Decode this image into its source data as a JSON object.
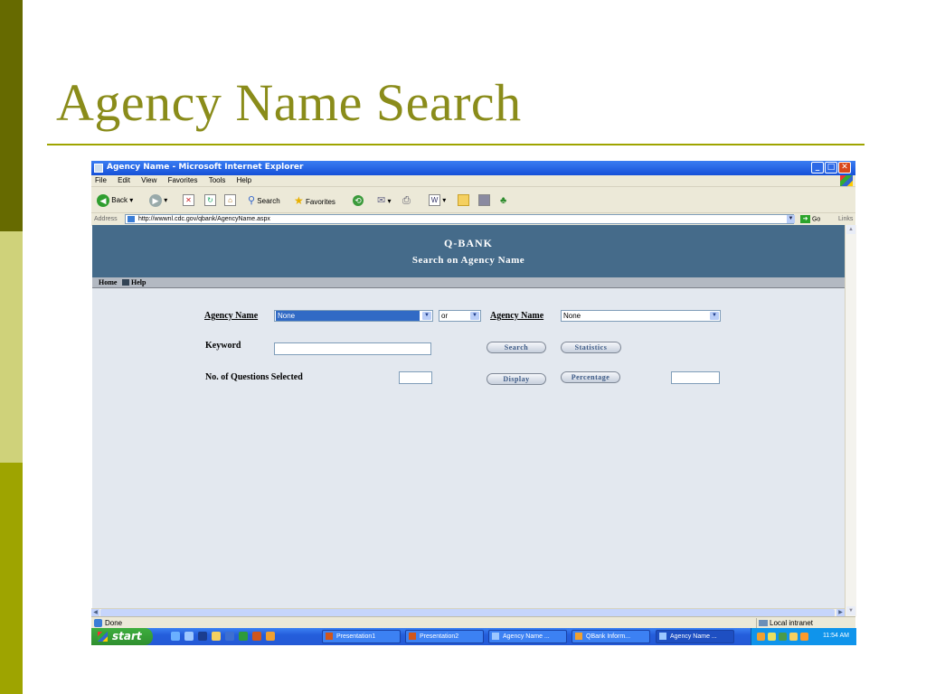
{
  "slide": {
    "title": "Agency Name Search"
  },
  "window": {
    "title": "Agency Name - Microsoft Internet Explorer",
    "min": "_",
    "max": "□",
    "close": "✕"
  },
  "menu": [
    "File",
    "Edit",
    "View",
    "Favorites",
    "Tools",
    "Help"
  ],
  "toolbar": {
    "back": "Back",
    "search": "Search",
    "favorites": "Favorites"
  },
  "address": {
    "label": "Address",
    "url": "http://wwwnl.cdc.gov/qbank/AgencyName.aspx",
    "go": "Go",
    "links": "Links"
  },
  "page": {
    "banner_title": "Q-BANK",
    "banner_subtitle": "Search on Agency Name",
    "nav": {
      "home": "Home",
      "help": "Help"
    },
    "form": {
      "agency_label_1": "Agency Name",
      "agency_select_1": "None",
      "or_select": "or",
      "agency_label_2": "Agency Name",
      "agency_select_2": "None",
      "keyword_label": "Keyword",
      "keyword_value": "",
      "search_button": "Search",
      "statistics_button": "Statistics",
      "questions_label": "No. of Questions Selected",
      "questions_value": "",
      "display_button": "Display",
      "percentage_button": "Percentage",
      "percentage_value": ""
    }
  },
  "status": {
    "text": "Done",
    "zone": "Local intranet"
  },
  "taskbar": {
    "start": "start",
    "tasks": [
      "Presentation1",
      "Presentation2",
      "Agency Name ...",
      "QBank Inform...",
      "Agency Name ..."
    ],
    "clock": "11:54 AM"
  },
  "colors": {
    "accent_olive": "#8a8c1a",
    "banner": "#456b8a",
    "page_bg": "#e3e8ef"
  }
}
